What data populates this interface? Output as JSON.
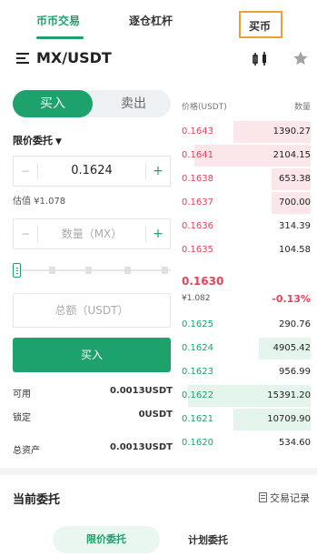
{
  "top_tabs": {
    "spot": "币币交易",
    "margin": "逐仓杠杆",
    "buy_coin": "买币"
  },
  "header": {
    "pair": "MX/USDT"
  },
  "trade_form": {
    "buy_label": "买入",
    "sell_label": "卖出",
    "order_type": "限价委托",
    "price_value": "0.1624",
    "minus": "−",
    "plus": "+",
    "estimate": "估值 ¥1.078",
    "amount_placeholder": "数量（MX）",
    "total_placeholder": "总额（USDT）",
    "submit_label": "买入",
    "slider_percent": 0
  },
  "balances": [
    {
      "label": "可用",
      "value": "0.0013USDT"
    },
    {
      "label": "锁定",
      "value": "0USDT"
    },
    {
      "label": "总资产",
      "value": "0.0013USDT"
    }
  ],
  "orderbook": {
    "price_header": "价格(USDT)",
    "qty_header": "数量",
    "asks": [
      {
        "price": "0.1643",
        "qty": "1390.27",
        "depth": 0.6
      },
      {
        "price": "0.1641",
        "qty": "2104.15",
        "depth": 0.9
      },
      {
        "price": "0.1638",
        "qty": "653.38",
        "depth": 0.3
      },
      {
        "price": "0.1637",
        "qty": "700.00",
        "depth": 0.3
      },
      {
        "price": "0.1636",
        "qty": "314.39",
        "depth": 0.0
      },
      {
        "price": "0.1635",
        "qty": "104.58",
        "depth": 0.0
      }
    ],
    "last_price": "0.1630",
    "last_cny": "¥1.082",
    "change": "-0.13%",
    "bids": [
      {
        "price": "0.1625",
        "qty": "290.76",
        "depth": 0.0
      },
      {
        "price": "0.1624",
        "qty": "4905.42",
        "depth": 0.4
      },
      {
        "price": "0.1623",
        "qty": "956.99",
        "depth": 0.0
      },
      {
        "price": "0.1622",
        "qty": "15391.20",
        "depth": 0.95
      },
      {
        "price": "0.1621",
        "qty": "10709.90",
        "depth": 0.6
      },
      {
        "price": "0.1620",
        "qty": "534.60",
        "depth": 0.0
      }
    ]
  },
  "orders": {
    "title": "当前委托",
    "history": "交易记录",
    "limit_tab": "限价委托",
    "plan_tab": "计划委托"
  },
  "colors": {
    "accent": "#1da26b",
    "ask": "#e0455a",
    "highlight_box": "#f0a030"
  }
}
